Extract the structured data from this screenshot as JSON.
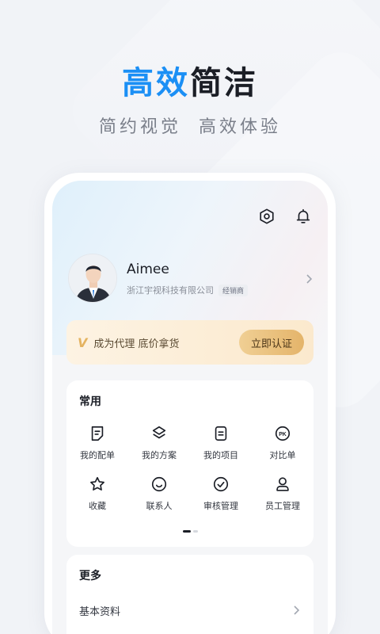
{
  "promo": {
    "headline_blue": "高效",
    "headline_dark": "简洁",
    "subline": "简约视觉  高效体验"
  },
  "header": {
    "settings_icon": "settings-icon",
    "bell_icon": "bell-icon"
  },
  "profile": {
    "name": "Aimee",
    "company": "浙江宇视科技有限公司",
    "tag": "经销商"
  },
  "agent_banner": {
    "mark": "V",
    "text": "成为代理 底价拿货",
    "button_label": "立即认证"
  },
  "common": {
    "title": "常用",
    "items": [
      {
        "label": "我的配单",
        "icon": "order-icon"
      },
      {
        "label": "我的方案",
        "icon": "layers-icon"
      },
      {
        "label": "我的项目",
        "icon": "project-icon"
      },
      {
        "label": "对比单",
        "icon": "pk-icon"
      },
      {
        "label": "收藏",
        "icon": "star-icon"
      },
      {
        "label": "联系人",
        "icon": "smile-icon"
      },
      {
        "label": "审核管理",
        "icon": "check-circle-icon"
      },
      {
        "label": "员工管理",
        "icon": "person-icon"
      }
    ]
  },
  "more": {
    "title": "更多",
    "items": [
      {
        "label": "基本资料"
      }
    ]
  },
  "colors": {
    "accent_blue": "#1b8ff5",
    "gold": "#e4b46a"
  }
}
